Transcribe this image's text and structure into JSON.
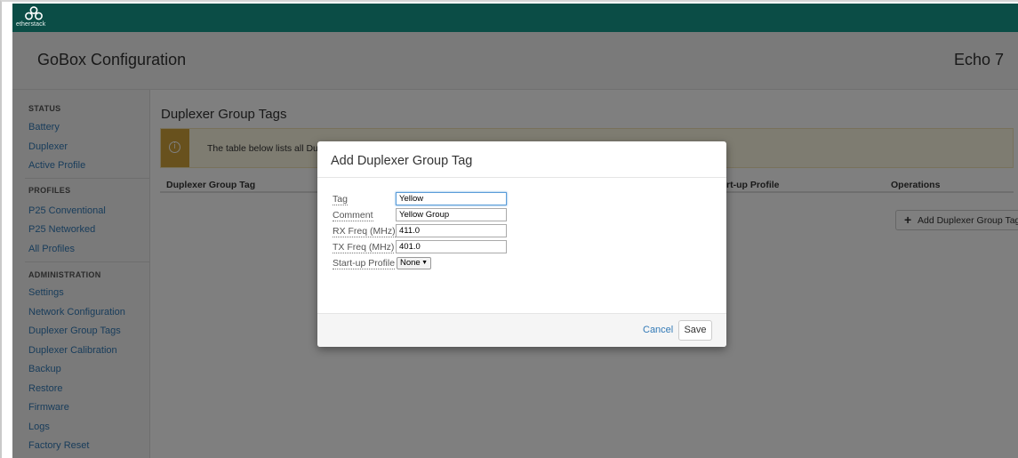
{
  "brand": {
    "name": "etherstack",
    "logo_icon": "etherstack-logo-icon"
  },
  "header": {
    "title": "GoBox Configuration",
    "device": "Echo 7"
  },
  "sidebar": {
    "sections": [
      {
        "heading": "STATUS",
        "items": [
          "Battery",
          "Duplexer",
          "Active Profile"
        ]
      },
      {
        "heading": "PROFILES",
        "items": [
          "P25 Conventional",
          "P25 Networked",
          "All Profiles"
        ]
      },
      {
        "heading": "ADMINISTRATION",
        "items": [
          "Settings",
          "Network Configuration",
          "Duplexer Group Tags",
          "Duplexer Calibration",
          "Backup",
          "Restore",
          "Firmware",
          "Logs",
          "Factory Reset"
        ]
      }
    ]
  },
  "main": {
    "title": "Duplexer Group Tags",
    "alert_text": "The table below lists all Du",
    "alert_icon": "info-circle-icon",
    "columns": [
      "Duplexer Group Tag",
      "rt-up Profile",
      "Operations"
    ],
    "add_button": "Add Duplexer Group Tag"
  },
  "modal": {
    "title": "Add Duplexer Group Tag",
    "fields": [
      {
        "label": "Tag",
        "value": "Yellow"
      },
      {
        "label": "Comment",
        "value": "Yellow Group"
      },
      {
        "label": "RX Freq (MHz)",
        "value": "411.0"
      },
      {
        "label": "TX Freq (MHz)",
        "value": "401.0"
      },
      {
        "label": "Start-up Profile",
        "value": "None"
      }
    ],
    "cancel_label": "Cancel",
    "save_label": "Save"
  },
  "colors": {
    "topbar": "#0b4d46",
    "link": "#337ab7",
    "alert_stripe": "#d1a33b"
  }
}
